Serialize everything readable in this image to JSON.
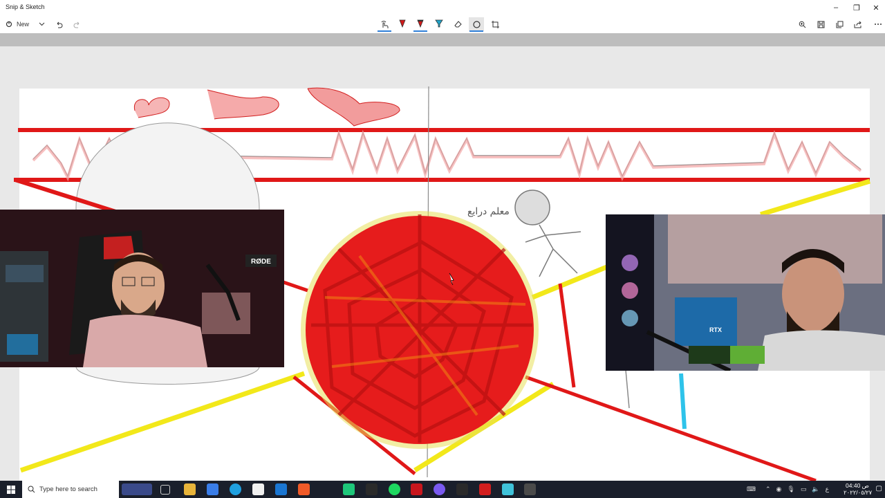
{
  "app": {
    "title": "Snip & Sketch"
  },
  "window_controls": [
    "minimize",
    "restore",
    "close"
  ],
  "toolbar": {
    "new_label": "New",
    "tools": [
      {
        "icon": "touch-writing-icon",
        "color": "#333333",
        "active": false
      },
      {
        "icon": "ballpoint-pen-icon",
        "color": "#d11a1a",
        "active": false
      },
      {
        "icon": "pencil-icon",
        "color": "#d11a1a",
        "active": false
      },
      {
        "icon": "highlighter-icon",
        "color": "#1fa3c9",
        "active": false
      },
      {
        "icon": "eraser-icon",
        "color": "#333333",
        "active": false
      },
      {
        "icon": "protractor-icon",
        "color": "#333333",
        "active": true
      },
      {
        "icon": "crop-icon",
        "color": "#333333",
        "active": false
      }
    ],
    "right_icons": [
      "zoom-icon",
      "save-icon",
      "copy-icon",
      "share-icon",
      "more-icon"
    ]
  },
  "canvas": {
    "drawing_colors": {
      "red": "#e01818",
      "yellow": "#f2e81a",
      "cyan": "#2ec3ea",
      "gray": "#8a8a8a"
    },
    "sketch_text": "معلم\nدرايع"
  },
  "taskbar": {
    "search_placeholder": "Type here to search",
    "tray": {
      "language": "ع",
      "time": "04:40 ص",
      "date": "٢٠٢٢/٠٥/٢٧"
    }
  }
}
